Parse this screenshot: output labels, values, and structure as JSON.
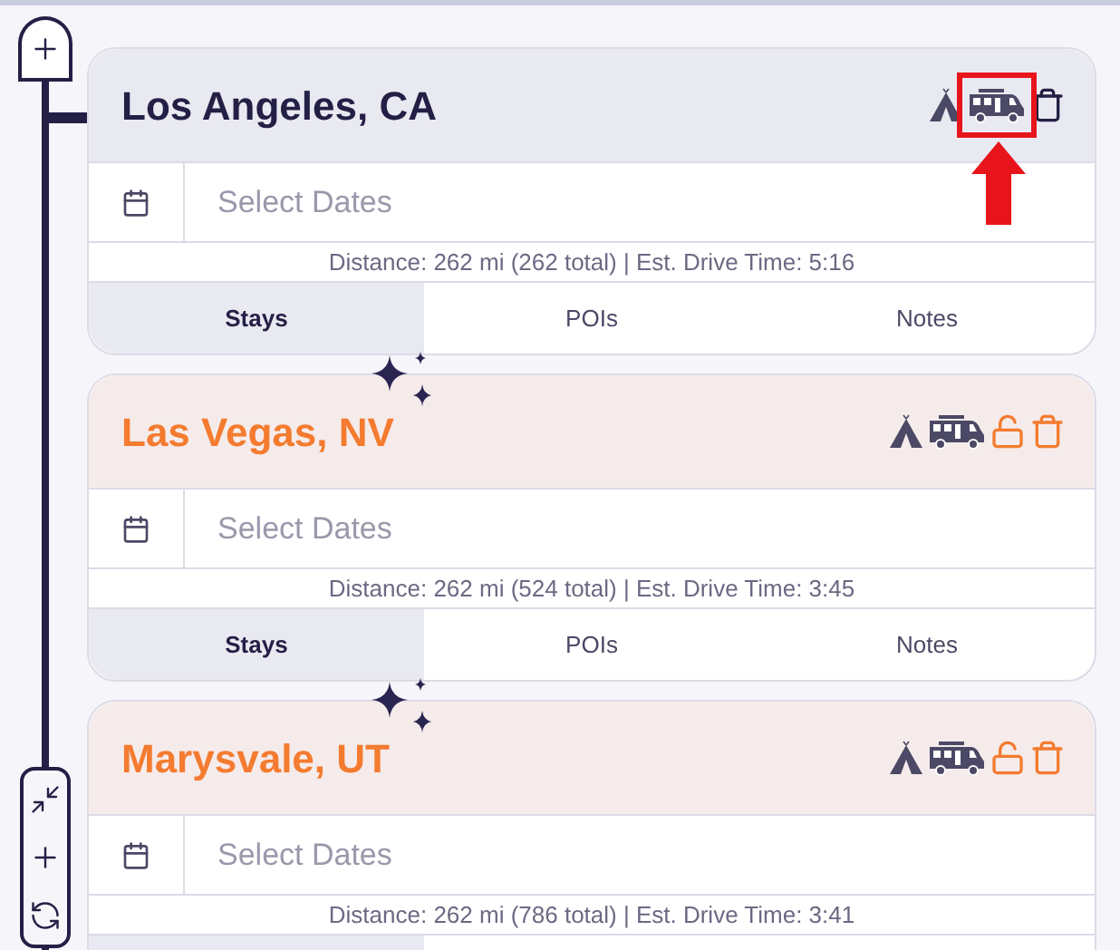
{
  "stops": [
    {
      "kind": "start",
      "name": "Los Angeles, CA",
      "rv_highlighted": true,
      "dates": {
        "placeholder": "Select Dates"
      },
      "distance": "Distance: 262 mi (262 total) | Est. Drive Time: 5:16",
      "tabs": [
        {
          "label": "Stays",
          "selected": true
        },
        {
          "label": "POIs",
          "selected": false
        },
        {
          "label": "Notes",
          "selected": false
        }
      ]
    },
    {
      "kind": "stop",
      "name": "Las Vegas, NV",
      "locked": false,
      "rv_highlighted": false,
      "dates": {
        "placeholder": "Select Dates"
      },
      "distance": "Distance: 262 mi (524 total) | Est. Drive Time: 3:45",
      "tabs": [
        {
          "label": "Stays",
          "selected": true
        },
        {
          "label": "POIs",
          "selected": false
        },
        {
          "label": "Notes",
          "selected": false
        }
      ]
    },
    {
      "kind": "stop",
      "name": "Marysvale, UT",
      "locked": false,
      "rv_highlighted": false,
      "dates": {
        "placeholder": "Select Dates"
      },
      "distance": "Distance: 262 mi (786 total) | Est. Drive Time: 3:41",
      "tabs": [
        {
          "selected": true
        }
      ]
    }
  ]
}
